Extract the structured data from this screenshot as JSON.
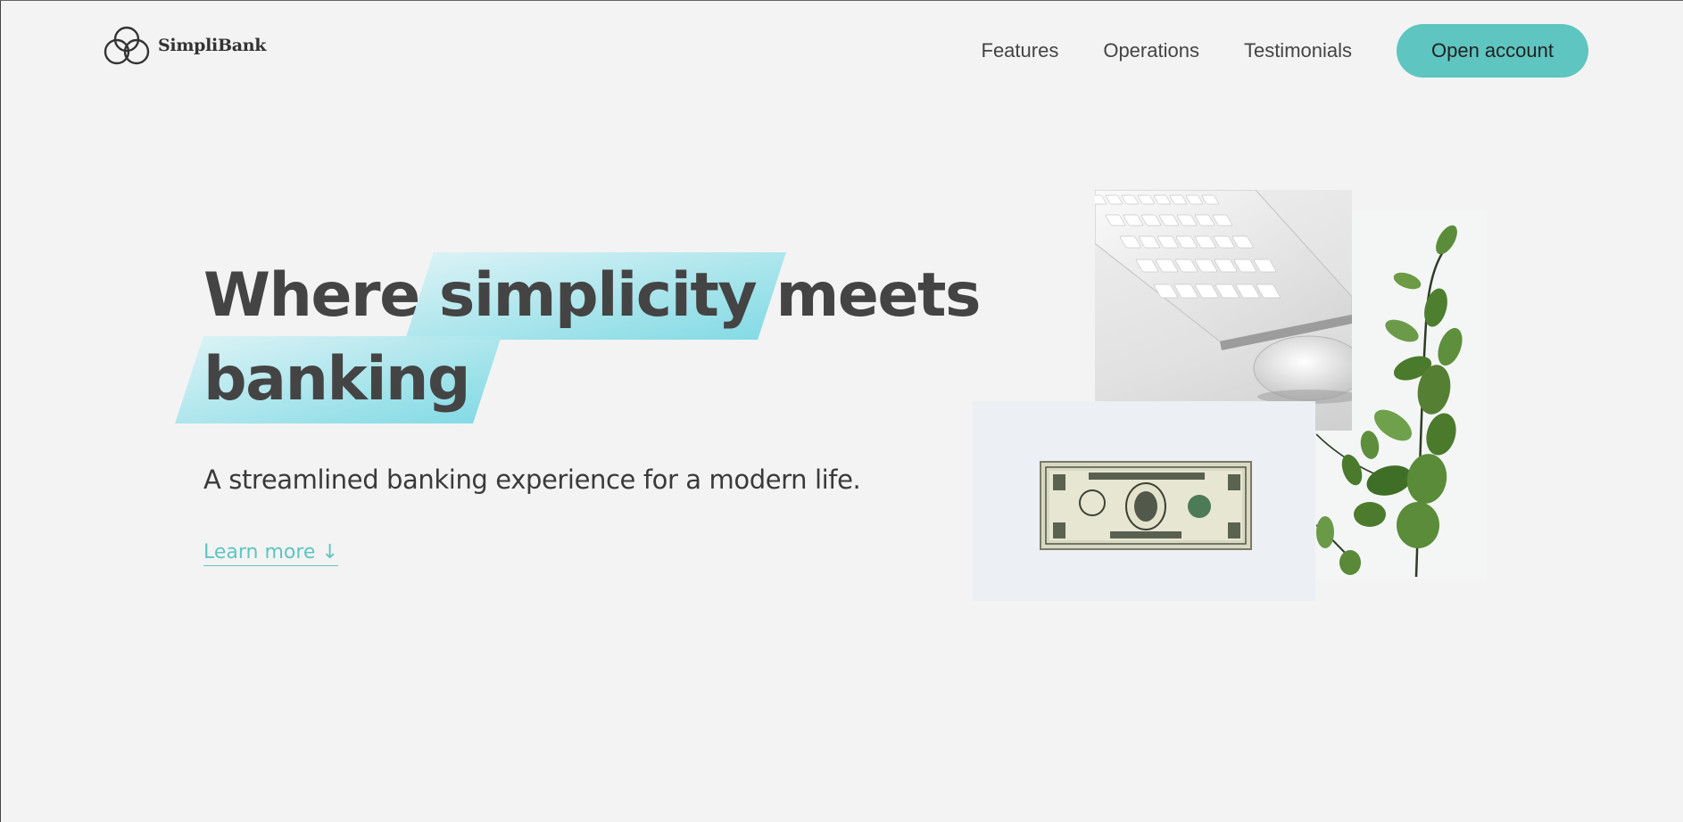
{
  "brand": {
    "name": "SimpliBank",
    "accent_color": "#5ec5c0"
  },
  "nav": {
    "links": [
      "Features",
      "Operations",
      "Testimonials"
    ],
    "cta": "Open account"
  },
  "hero": {
    "headline_prefix": "Where ",
    "headline_highlight_1": "simplicity",
    "headline_middle": " meets",
    "headline_highlight_2": "banking",
    "subtitle": "A streamlined banking experience for a modern life.",
    "link": "Learn more ↓"
  },
  "images": {
    "keyboard": "keyboard-and-mouse-photo",
    "plant": "eucalyptus-plant-photo",
    "dollar": "one-dollar-bill-photo"
  }
}
